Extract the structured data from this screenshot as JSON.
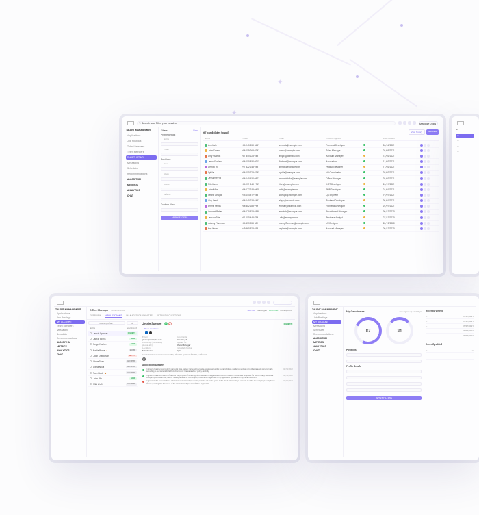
{
  "colors": {
    "accent": "#8e7df5"
  },
  "topbar": {
    "search_placeholder": "Search and filter your results",
    "user_label": "Manage Jobs"
  },
  "sidebar": {
    "section1": "TALENT MANAGEMENT",
    "items1": [
      "Applications",
      "Job Postings",
      "Talent Database",
      "Team Members"
    ],
    "active": "SHORTLISTING",
    "items2": [
      "Messaging",
      "Scheduler"
    ],
    "items3_header": "Recommendations",
    "items3": [
      "ALGORITHM",
      "METRICS",
      "ANALYTICS",
      "CHAT"
    ]
  },
  "filters": {
    "header": "Filters",
    "clear": "Clear",
    "group1": "Profile details",
    "opts1": [
      "Name",
      "Email"
    ],
    "group2": "Positions",
    "opts2": [
      "Role",
      "Stage",
      "Status",
      "Referral"
    ],
    "group3": "Custom View",
    "apply": "APPLY FILTERS"
  },
  "table": {
    "count_label": "67 candidates found",
    "history_btn": "View history",
    "export_btn": "Generate",
    "columns": [
      "Name",
      "Phone",
      "Email",
      "Position applied",
      "",
      "Date created",
      ""
    ],
    "rows": [
      {
        "color": "#4dbd78",
        "name": "Ann Kals",
        "phone": "+86 143 235-4431",
        "email": "ann.kals@example.com",
        "pos": "Frontend Developer",
        "st": "g",
        "date": "04/04/2021"
      },
      {
        "color": "#efb341",
        "name": "John Carson",
        "phone": "+86 159 265-8291",
        "email": "john.c@example.com",
        "pos": "Sales Manager",
        "st": "g",
        "date": "28/03/2021"
      },
      {
        "color": "#e5744b",
        "name": "Amy Hudson",
        "phone": "+81 445 223-245",
        "email": "amy84@domain.com",
        "pos": "Account Manager",
        "st": "o",
        "date": "13/02/2021"
      },
      {
        "color": "#6aa4e8",
        "name": "Jenny Fortland",
        "phone": "+86 155 850-9213",
        "email": "jfortland@example.com",
        "pos": "Accountant",
        "st": "g",
        "date": "11/02/2021"
      },
      {
        "color": "#bb69e0",
        "name": "Derrick Ho",
        "phone": "+91 322 243-785",
        "email": "derrick@example.com",
        "pos": "Product Designer",
        "st": "o",
        "date": "11/02/2021"
      },
      {
        "color": "#e5744b",
        "name": "Sybilla",
        "phone": "+86 150 728-8793",
        "email": "sybilla@example.com",
        "pos": "HR Coordinator",
        "st": "g",
        "date": "05/02/2021"
      },
      {
        "color": "#4dbd78",
        "name": "Jessamie Hill",
        "phone": "+86 145 630-9501",
        "email": "jessamiehillw@example.com",
        "pos": "Office Manager",
        "st": "g",
        "date": "03/02/2021"
      },
      {
        "color": "#4dbd78",
        "name": "Rita Hass",
        "phone": "+86 151 245-1749",
        "email": "rita.h@example.com",
        "pos": ".NET Developer",
        "st": "o",
        "date": "24/01/2021"
      },
      {
        "color": "#efb341",
        "name": "John Mile",
        "phone": "+86 177 745-9429",
        "email": "jmile@example.com",
        "pos": "PHP Developer",
        "st": "g",
        "date": "24/01/2021"
      },
      {
        "color": "#4dbd78",
        "name": "Serina Cowgill",
        "phone": "+44 244 517-248",
        "email": "scowgill@example.com",
        "pos": "QA Engineer",
        "st": "g",
        "date": "19/01/2021"
      },
      {
        "color": "#6aa4e8",
        "name": "Alvy Parol",
        "phone": "+86 145 235-4431",
        "email": "alvy.p@example.com",
        "pos": "Backend Developer",
        "st": "o",
        "date": "08/01/2021"
      },
      {
        "color": "#bb69e0",
        "name": "Emma Reeds",
        "phone": "+86 402 288-799",
        "email": "emma.r@example.com",
        "pos": "Frontend Developer",
        "st": "g",
        "date": "01/01/2021"
      },
      {
        "color": "#4dbd78",
        "name": "Armond Batler",
        "phone": "+86 175 528-2588",
        "email": "arm.hatr@example.com",
        "pos": "Recruitment Manager",
        "st": "g",
        "date": "30/12/2020"
      },
      {
        "color": "#efb341",
        "name": "Jessica Dile",
        "phone": "+81 150 443-739",
        "email": "j.dile@example.com",
        "pos": "Business Analyst",
        "st": "o",
        "date": "27/12/2020"
      },
      {
        "color": "#4dbd78",
        "name": "Johnny Flamman",
        "phone": "+86 475 538-981",
        "email": "johnny.flamman@example.com",
        "pos": "UX Designer",
        "st": "g",
        "date": "20/12/2020"
      },
      {
        "color": "#e5744b",
        "name": "Kay Linde",
        "phone": "+49 465 528-838",
        "email": "kaylinde@example.com",
        "pos": "Account Manager",
        "st": "o",
        "date": "20/12/2020"
      }
    ]
  },
  "frame2": {
    "title": "Office Manager",
    "title_loc": "MANCHESTER",
    "top_right": [
      "Add new",
      "Messages",
      "Download",
      "More options"
    ],
    "tabs": [
      "OVERVIEW",
      "APPLICATIONS",
      "MANAGED CANDIDATES",
      "DETAILS & QUESTIONS"
    ],
    "active_tab": "APPLICATIONS",
    "list_sort_label": "External profiles",
    "cand_header": [
      "Name",
      "Sourcing fit"
    ],
    "candidates": [
      {
        "name": "Jessie Spencer",
        "badge": "FAVORITE",
        "cls": "b-green",
        "selected": true
      },
      {
        "name": "Jackie Evans",
        "badge": "GOOD",
        "cls": "b-green"
      },
      {
        "name": "Serge Voullen",
        "badge": "GOOD",
        "cls": "b-green"
      },
      {
        "name": "Nadia Roma",
        "badge": "MAYBE",
        "cls": "b-grey",
        "warn": true
      },
      {
        "name": "John Kristopson",
        "badge": "NOT FIT",
        "cls": "b-red"
      },
      {
        "name": "Chloe Duss",
        "badge": "ARCHIVED",
        "cls": "b-grey"
      },
      {
        "name": "Diana Nova",
        "badge": "ARCHIVED",
        "cls": "b-grey"
      },
      {
        "name": "Tom Wuds",
        "badge": "ARCHIVED",
        "cls": "b-grey",
        "warn": true
      },
      {
        "name": "John Bils",
        "badge": "GOOD",
        "cls": "b-green"
      },
      {
        "name": "Mild Wolfe",
        "badge": "ARCHIVED",
        "cls": "b-grey"
      }
    ],
    "detail": {
      "name": "Jessie Spencer",
      "status": "FAVORITE",
      "short_info_label": "Show short info",
      "pairs": [
        {
          "k": "Email",
          "v": "jessie@example.com"
        },
        {
          "k": "Documents",
          "v": "Resume.pdf"
        },
        {
          "k": "Follow-up (mandatory phone, etc)",
          "v": ""
        },
        {
          "k": "Applied for",
          "v": "Office Manager"
        },
        {
          "k": "Location",
          "v": "Manchester"
        },
        {
          "k": "Candidate Notes",
          "v": "Open"
        }
      ],
      "note_line": "Check the interview session recording after the applicant fills the portfolio in",
      "dot_label": "RC",
      "section": "Application Answers",
      "answers": [
        {
          "ok": true,
          "text": "I agree to the processing of my personal data, namely name and surname, telephone number, e-mail address, residence address and other relevant personal data according to our General Data Protection policy. Please read our policy carefully.",
          "date": "08/12/2021"
        },
        {
          "ok": true,
          "text": "I agree to the transmission of data for the purpose of receiving informational mailing about current commercial recruitment proposals for the company via regular company-provided e-mail, SMS or mailing address at the company's discretion registered in my application applicable to my current position.",
          "date": "08/12/2021"
        },
        {
          "ok": false,
          "text": "I agree that the personal data I submit before the email processing shall be set for ten years in the direct intermediary's use that is within the company's compliance. If non-operating, the discretion of the small detailed provider of these applicants.",
          "date": "08/12/2021"
        }
      ]
    }
  },
  "frame3": {
    "title": "My Candidates",
    "bar_label": "You signed up on 2 days",
    "form_header1": "Positions",
    "form_header2": "Profile details",
    "apply": "APPLY FILTERS",
    "recently_title": "Recently viewed",
    "recently": [
      {
        "label": "—",
        "v": "01/07/2021"
      },
      {
        "label": "—",
        "v": "01/07/2021"
      },
      {
        "label": "—",
        "v": "01/07/2021"
      },
      {
        "label": "—",
        "v": "01/07/2021"
      },
      {
        "label": "—",
        "v": "01/07/2021"
      }
    ],
    "ring1": "87",
    "ring2": "21",
    "recently_sub": "Recently added"
  },
  "sidebar2": {
    "section1": "TALENT MANAGEMENT",
    "items1": [
      "Applications",
      "Job Postings",
      "Talent Database",
      "Team Members"
    ],
    "active": "MY ACCOUNT",
    "items2": [
      "Messaging",
      "Scheduler"
    ],
    "items3": [
      "ALGORITHM",
      "METRICS",
      "ANALYTICS",
      "CHAT"
    ]
  }
}
